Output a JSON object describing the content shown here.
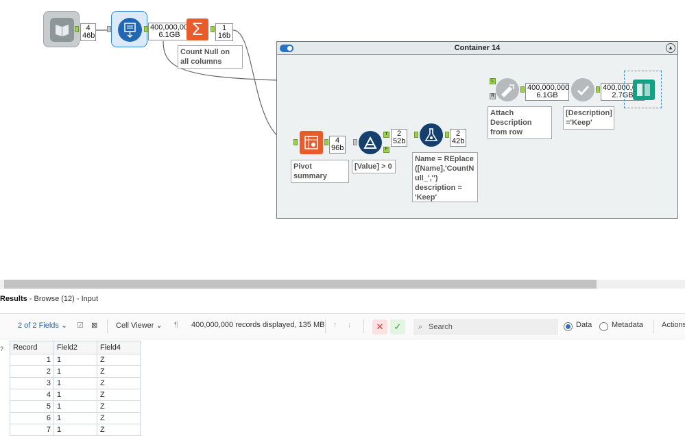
{
  "canvas": {
    "tool_book": {
      "icon": "book-icon"
    },
    "tool_input": {
      "icon": "data-input-icon",
      "badge_top": "4",
      "badge_bottom": "46b"
    },
    "input_output_badge": {
      "top": "400,000,000",
      "bottom": "6.1GB"
    },
    "summarize": {
      "icon": "sigma-icon",
      "badge_top": "1",
      "badge_bottom": "16b",
      "annotation": "Count Null on all columns"
    },
    "pivot": {
      "icon": "pivot-icon",
      "annotation": "Pivot summary",
      "badge_top": "4",
      "badge_bottom": "96b"
    },
    "filter": {
      "icon": "filter-icon",
      "annotation": "[Value] > 0",
      "anchor_true": "T",
      "anchor_false": "F",
      "badge_top": "2",
      "badge_bottom": "52b"
    },
    "formula": {
      "icon": "formula-flask-icon",
      "annotation": "Name = REplace ([Name],'CountN ull_','') description = 'Keep'",
      "badge_top": "2",
      "badge_bottom": "42b"
    },
    "container": {
      "title": "Container 14"
    },
    "append": {
      "icon": "append-fields-icon",
      "anchor_l": "L",
      "anchor_r": "R",
      "annotation": "Attach Description from row",
      "badge_top": "400,000,000",
      "badge_bottom": "6.1GB"
    },
    "filter2": {
      "icon": "check-filter-icon",
      "annotation": "[Description] ='Keep'",
      "badge_top": "400,000,000",
      "badge_bottom": "2.7GB"
    },
    "browse": {
      "icon": "browse-book-icon"
    }
  },
  "results": {
    "title": "Results",
    "subtitle": " - Browse (12) - Input",
    "fields_label": "2 of 2 Fields",
    "viewer_label": "Cell Viewer",
    "records_text": "400,000,000 records displayed, 135 MB",
    "search_placeholder": "Search",
    "radio_data": "Data",
    "radio_metadata": "Metadata",
    "actions": "Actions"
  },
  "grid": {
    "columns": [
      "Record",
      "Field2",
      "Field4"
    ],
    "rows": [
      [
        "1",
        "1",
        "Z"
      ],
      [
        "2",
        "1",
        "Z"
      ],
      [
        "3",
        "1",
        "Z"
      ],
      [
        "4",
        "1",
        "Z"
      ],
      [
        "5",
        "1",
        "Z"
      ],
      [
        "6",
        "1",
        "Z"
      ],
      [
        "7",
        "1",
        "Z"
      ]
    ]
  },
  "colors": {
    "accent": "#2a72c4",
    "anchor_green": "#9ccf4b",
    "sigma_orange": "#e85b2a",
    "tool_navy": "#15406e"
  }
}
